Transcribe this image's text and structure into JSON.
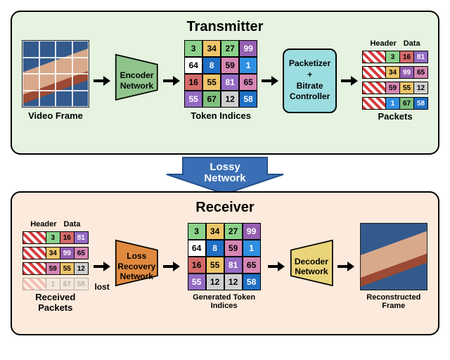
{
  "transmitter": {
    "title": "Transmitter",
    "frame_label": "Video Frame",
    "encoder_label": "Encoder Network",
    "tokens_label": "Token Indices",
    "packetizer_label": "Packetizer\n+\nBitrate Controller",
    "packets_header_label": "Header",
    "packets_data_label": "Data",
    "packets_label": "Packets",
    "tokens": [
      [
        3,
        34,
        27,
        99
      ],
      [
        64,
        8,
        59,
        1
      ],
      [
        16,
        55,
        81,
        65
      ],
      [
        55,
        67,
        12,
        58
      ]
    ],
    "token_colors": [
      [
        "#8bd18b",
        "#eec56a",
        "#8bd18b",
        "#955fb0"
      ],
      [
        "#ffffff",
        "#1f6fc4",
        "#d686b3",
        "#2f8fe0"
      ],
      [
        "#d46a6a",
        "#eec56a",
        "#946bc4",
        "#d686b3"
      ],
      [
        "#946bc4",
        "#7fbf7f",
        "#cfcfcf",
        "#1f6fc4"
      ]
    ],
    "packets": [
      {
        "cells": [
          3,
          16,
          81
        ],
        "colors": [
          "#8bd18b",
          "#d46a6a",
          "#946bc4"
        ]
      },
      {
        "cells": [
          34,
          99,
          65
        ],
        "colors": [
          "#eec56a",
          "#955fb0",
          "#d686b3"
        ]
      },
      {
        "cells": [
          59,
          55,
          12
        ],
        "colors": [
          "#d686b3",
          "#eec56a",
          "#cfcfcf"
        ]
      },
      {
        "cells": [
          1,
          67,
          58
        ],
        "colors": [
          "#2f8fe0",
          "#7fbf7f",
          "#1f6fc4"
        ]
      }
    ]
  },
  "lossy_label": "Lossy\nNetwork",
  "receiver": {
    "title": "Receiver",
    "packets_header_label": "Header",
    "packets_data_label": "Data",
    "received_label": "Received Packets",
    "lost_text": "lost",
    "loss_recovery_label": "Loss Recovery Network",
    "gen_tokens_label": "Generated Token Indices",
    "decoder_label": "Decoder Network",
    "recon_label": "Reconstructed Frame",
    "received_packets": [
      {
        "cells": [
          3,
          16,
          81
        ],
        "colors": [
          "#8bd18b",
          "#d46a6a",
          "#946bc4"
        ],
        "lost": false
      },
      {
        "cells": [
          34,
          99,
          65
        ],
        "colors": [
          "#eec56a",
          "#955fb0",
          "#d686b3"
        ],
        "lost": false
      },
      {
        "cells": [
          59,
          55,
          12
        ],
        "colors": [
          "#d686b3",
          "#eec56a",
          "#cfcfcf"
        ],
        "lost": false
      },
      {
        "cells": [
          1,
          67,
          58
        ],
        "colors": [
          "#dddddd",
          "#dddddd",
          "#dddddd"
        ],
        "lost": true
      }
    ],
    "gen_tokens": [
      [
        3,
        34,
        27,
        99
      ],
      [
        64,
        8,
        59,
        1
      ],
      [
        16,
        55,
        81,
        65
      ],
      [
        55,
        12,
        12,
        58
      ]
    ],
    "gen_colors": [
      [
        "#8bd18b",
        "#eec56a",
        "#8bd18b",
        "#955fb0"
      ],
      [
        "#ffffff",
        "#1f6fc4",
        "#d686b3",
        "#2f8fe0"
      ],
      [
        "#d46a6a",
        "#eec56a",
        "#946bc4",
        "#d686b3"
      ],
      [
        "#946bc4",
        "#cfcfcf",
        "#cfcfcf",
        "#1f6fc4"
      ]
    ]
  },
  "chart_data": {
    "type": "table",
    "title": "Neural video codec pipeline diagram",
    "flow": [
      "Video Frame",
      "Encoder Network",
      "Token Indices",
      "Packetizer + Bitrate Controller",
      "Packets",
      "Lossy Network",
      "Received Packets",
      "Loss Recovery Network",
      "Generated Token Indices",
      "Decoder Network",
      "Reconstructed Frame"
    ],
    "token_indices_tx": [
      [
        3,
        34,
        27,
        99
      ],
      [
        64,
        8,
        59,
        1
      ],
      [
        16,
        55,
        81,
        65
      ],
      [
        55,
        67,
        12,
        58
      ]
    ],
    "packets_tx": [
      [
        3,
        16,
        81
      ],
      [
        34,
        99,
        65
      ],
      [
        59,
        55,
        12
      ],
      [
        1,
        67,
        58
      ]
    ],
    "packets_rx": [
      {
        "data": [
          3,
          16,
          81
        ],
        "lost": false
      },
      {
        "data": [
          34,
          99,
          65
        ],
        "lost": false
      },
      {
        "data": [
          59,
          55,
          12
        ],
        "lost": false
      },
      {
        "data": [
          1,
          67,
          58
        ],
        "lost": true
      }
    ],
    "token_indices_rx": [
      [
        3,
        34,
        27,
        99
      ],
      [
        64,
        8,
        59,
        1
      ],
      [
        16,
        55,
        81,
        65
      ],
      [
        55,
        12,
        12,
        58
      ]
    ]
  }
}
